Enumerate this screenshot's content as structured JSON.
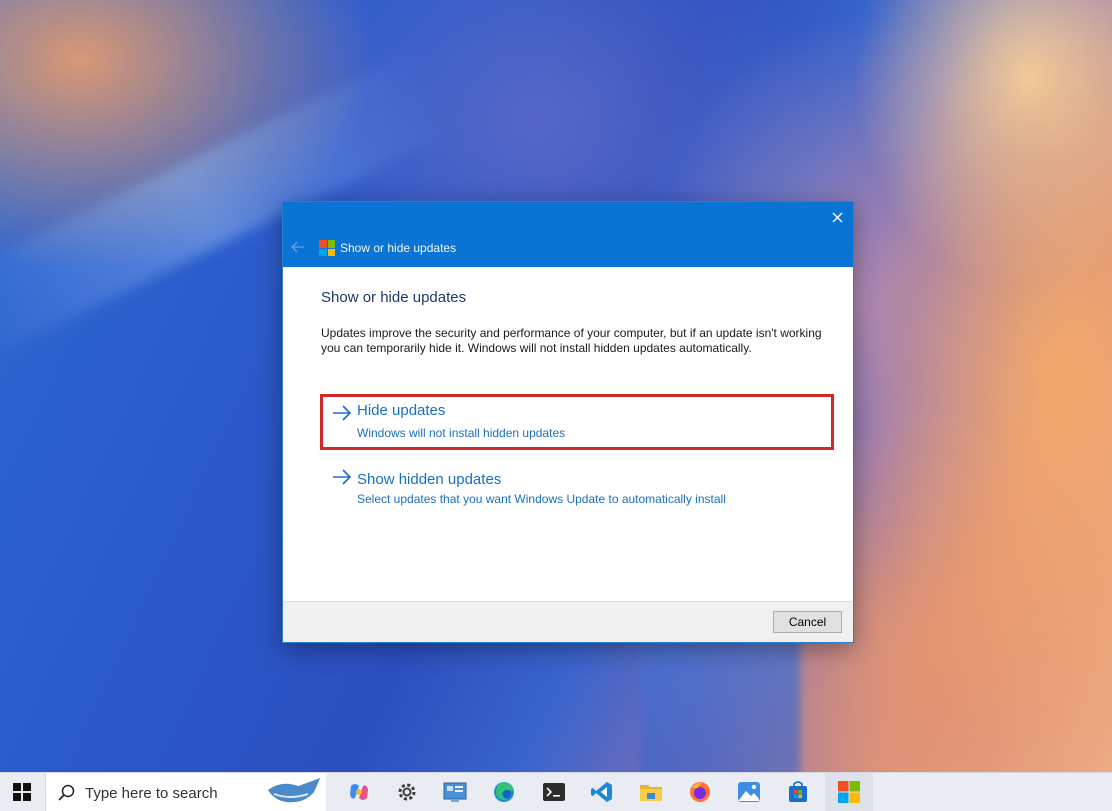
{
  "window": {
    "title": "Show or hide updates",
    "close_icon": "close-icon",
    "back_icon": "back-arrow-icon"
  },
  "content": {
    "heading": "Show or hide updates",
    "description": "Updates improve the security and performance of your computer, but if an update isn't working you can temporarily hide it. Windows will not install hidden updates automatically.",
    "options": [
      {
        "title": "Hide updates",
        "subtitle": "Windows will not install hidden updates",
        "highlighted": true
      },
      {
        "title": "Show hidden updates",
        "subtitle": "Select updates that you want Windows Update to automatically install",
        "highlighted": false
      }
    ]
  },
  "footer": {
    "cancel_label": "Cancel"
  },
  "taskbar": {
    "search_placeholder": "Type here to search",
    "pinned": [
      "start-icon",
      "copilot-icon",
      "settings-icon",
      "control-panel-icon",
      "edge-icon",
      "terminal-icon",
      "vscode-icon",
      "file-explorer-icon",
      "firefox-icon",
      "photos-icon",
      "store-icon",
      "windows-update-tool-icon"
    ]
  },
  "colors": {
    "titlebar": "#0a74d4",
    "link": "#1a6fc2",
    "highlight_border": "#d12a2a"
  }
}
